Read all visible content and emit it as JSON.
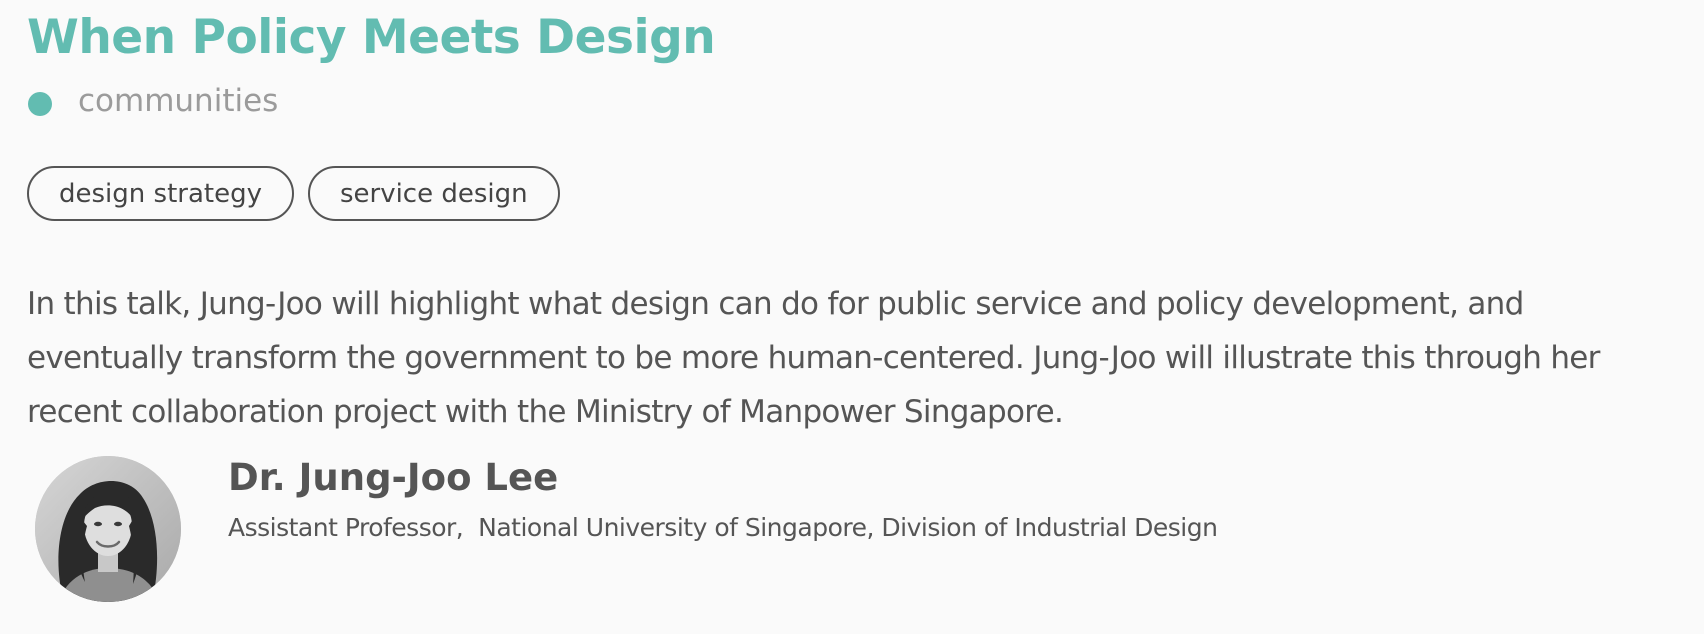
{
  "talk": {
    "title": "When Policy Meets Design",
    "category": "communities",
    "tags": [
      "design strategy",
      "service design"
    ],
    "description": "In this talk, Jung-Joo will highlight what design can do for public service and policy development, and eventually transform the government to be more human-centered. Jung-Joo will illustrate this through her recent collaboration project with the Ministry of Manpower Singapore."
  },
  "speaker": {
    "name": "Dr. Jung-Joo Lee",
    "affiliation": "Assistant Professor,  National University of Singapore, Division of Industrial Design",
    "photo_icon": "speaker-portrait-photo"
  },
  "colors": {
    "accent": "#62bcb1",
    "category_text": "#9b9b9b",
    "body_text": "#555555",
    "background": "#fafafa"
  }
}
